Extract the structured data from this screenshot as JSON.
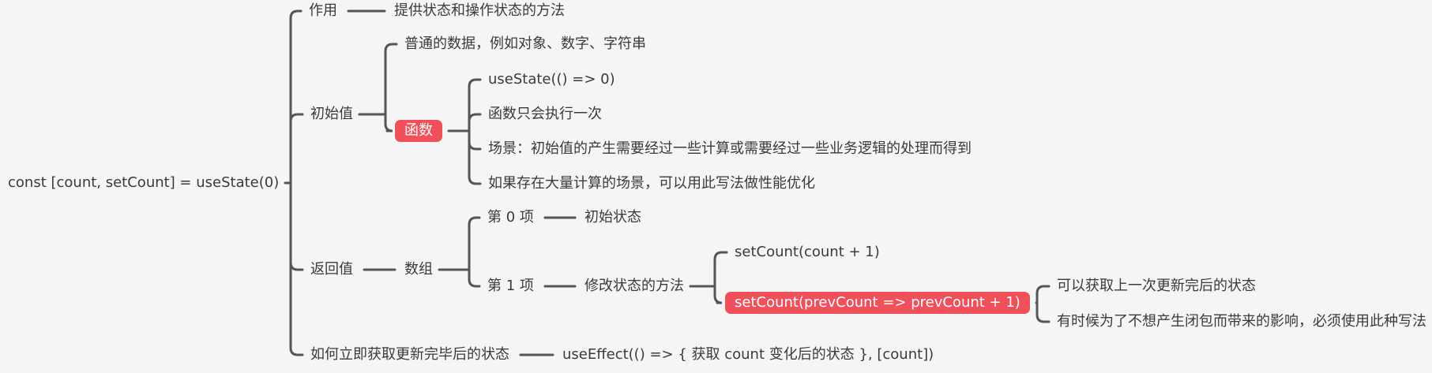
{
  "theme": {
    "line_color": "#555555",
    "highlight_color": "#f0505a",
    "background": "#f5f5f5"
  },
  "mindmap": {
    "root": "const [count, setCount] = useState(0)",
    "purpose": {
      "label": "作用",
      "desc": "提供状态和操作状态的方法"
    },
    "initial": {
      "label": "初始值",
      "plain": "普通的数据，例如对象、数字、字符串",
      "function": {
        "label": "函数",
        "items": [
          "useState(() => 0)",
          "函数只会执行一次",
          "场景：初始值的产生需要经过一些计算或需要经过一些业务逻辑的处理而得到",
          "如果存在大量计算的场景，可以用此写法做性能优化"
        ]
      }
    },
    "returns": {
      "label": "返回值",
      "array": "数组",
      "item0": {
        "label": "第 0 项",
        "desc": "初始状态"
      },
      "item1": {
        "label": "第 1 项",
        "desc": "修改状态的方法",
        "simple": "setCount(count + 1)",
        "callback": {
          "label": "setCount(prevCount => prevCount + 1)",
          "notes": [
            "可以获取上一次更新完后的状态",
            "有时候为了不想产生闭包而带来的影响，必须使用此种写法"
          ]
        }
      }
    },
    "immediate": {
      "label": "如何立即获取更新完毕后的状态",
      "desc": "useEffect(() => { 获取 count 变化后的状态 }, [count])"
    }
  }
}
